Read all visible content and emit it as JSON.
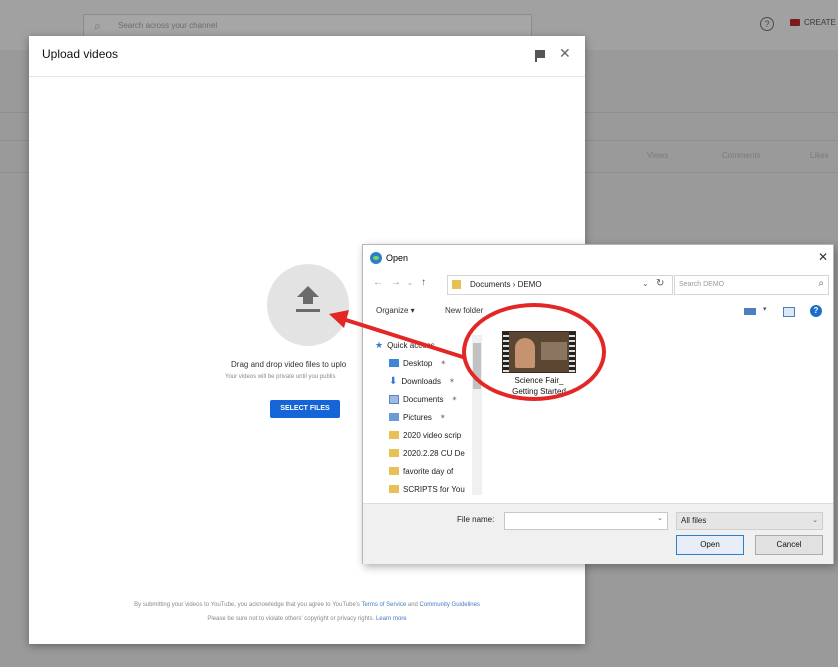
{
  "background": {
    "search_placeholder": "Search across your channel",
    "create_label": "CREATE",
    "columns": [
      "Views",
      "Comments",
      "Likes"
    ]
  },
  "upload_dialog": {
    "title": "Upload videos",
    "drag_text": "Drag and drop video files to uplo",
    "private_text": "Your videos will be private until you publis",
    "select_button": "SELECT FILES",
    "terms_prefix": "By submitting your videos to YouTube, you acknowledge that you agree to YouTube's",
    "terms_link": "Terms of Service",
    "terms_and": "and",
    "guidelines_link": "Community Guidelines",
    "rights_text": "Please be sure not to violate others' copyright or privacy rights.",
    "learn_more": "Learn more"
  },
  "open_dialog": {
    "title": "Open",
    "address_text": "Documents  ›  DEMO",
    "search_placeholder": "Search DEMO",
    "organize": "Organize ▾",
    "new_folder": "New folder",
    "nav_items": [
      {
        "label": "Quick access",
        "icon": "star-icon",
        "pinned": false
      },
      {
        "label": "Desktop",
        "icon": "desktop-icon",
        "pinned": true
      },
      {
        "label": "Downloads",
        "icon": "downloads-icon",
        "pinned": true
      },
      {
        "label": "Documents",
        "icon": "documents-icon",
        "pinned": true
      },
      {
        "label": "Pictures",
        "icon": "pictures-icon",
        "pinned": true
      },
      {
        "label": "2020 video scrip",
        "icon": "folder-icon",
        "pinned": false
      },
      {
        "label": "2020.2.28 CU De",
        "icon": "folder-icon",
        "pinned": false
      },
      {
        "label": "favorite day of",
        "icon": "folder-icon",
        "pinned": false
      },
      {
        "label": "SCRIPTS for You",
        "icon": "folder-icon",
        "pinned": false
      }
    ],
    "file": {
      "line1": "Science Fair_",
      "line2": "Getting Started"
    },
    "file_name_label": "File name:",
    "file_name_value": "",
    "filter": "All files",
    "open_button": "Open",
    "cancel_button": "Cancel"
  },
  "colors": {
    "select_button": "#1565d8",
    "annotation": "#e32626",
    "dim_overlay": "#9a9a9a"
  }
}
